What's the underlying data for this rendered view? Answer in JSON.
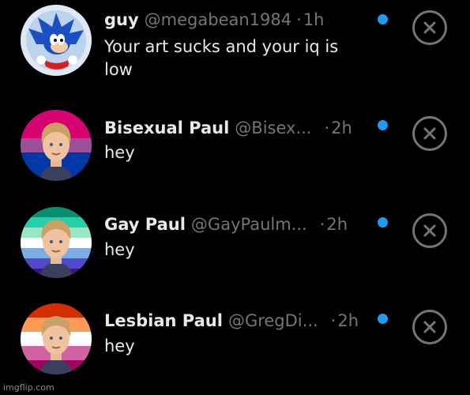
{
  "notifications": [
    {
      "name": "guy",
      "handle": "@megabean1984",
      "separator": "·",
      "time": "1h",
      "message": "Your art sucks and your iq is low",
      "avatar_icon": "sonic-avatar-icon",
      "unread": true
    },
    {
      "name": "Bisexual Paul",
      "handle": "@Bisex...",
      "separator": "·",
      "time": "2h",
      "message": "hey",
      "avatar_icon": "bisexual-flag-avatar-icon",
      "flag_colors": [
        "#d60270",
        "#9b4f96",
        "#0038a8"
      ],
      "unread": true
    },
    {
      "name": "Gay Paul",
      "handle": "@GayPaulm...",
      "separator": "·",
      "time": "2h",
      "message": "hey",
      "avatar_icon": "gay-men-flag-avatar-icon",
      "flag_colors": [
        "#078d70",
        "#26ceaa",
        "#98e8c1",
        "#ffffff",
        "#7bade2",
        "#5049cc",
        "#3d1a78"
      ],
      "unread": true
    },
    {
      "name": "Lesbian Paul",
      "handle": "@GregDi...",
      "separator": "·",
      "time": "2h",
      "message": "hey",
      "avatar_icon": "lesbian-flag-avatar-icon",
      "flag_colors": [
        "#d52d00",
        "#ff9a56",
        "#ffffff",
        "#d362a4",
        "#a30262"
      ],
      "unread": true
    }
  ],
  "icons": {
    "unread": "unread-dot-icon",
    "dismiss": "close-circle-icon"
  },
  "colors": {
    "background": "#000000",
    "primary_text": "#e7e9ea",
    "secondary_text": "#71767b",
    "accent": "#1d9bf0"
  },
  "watermark": "imgflip.com"
}
